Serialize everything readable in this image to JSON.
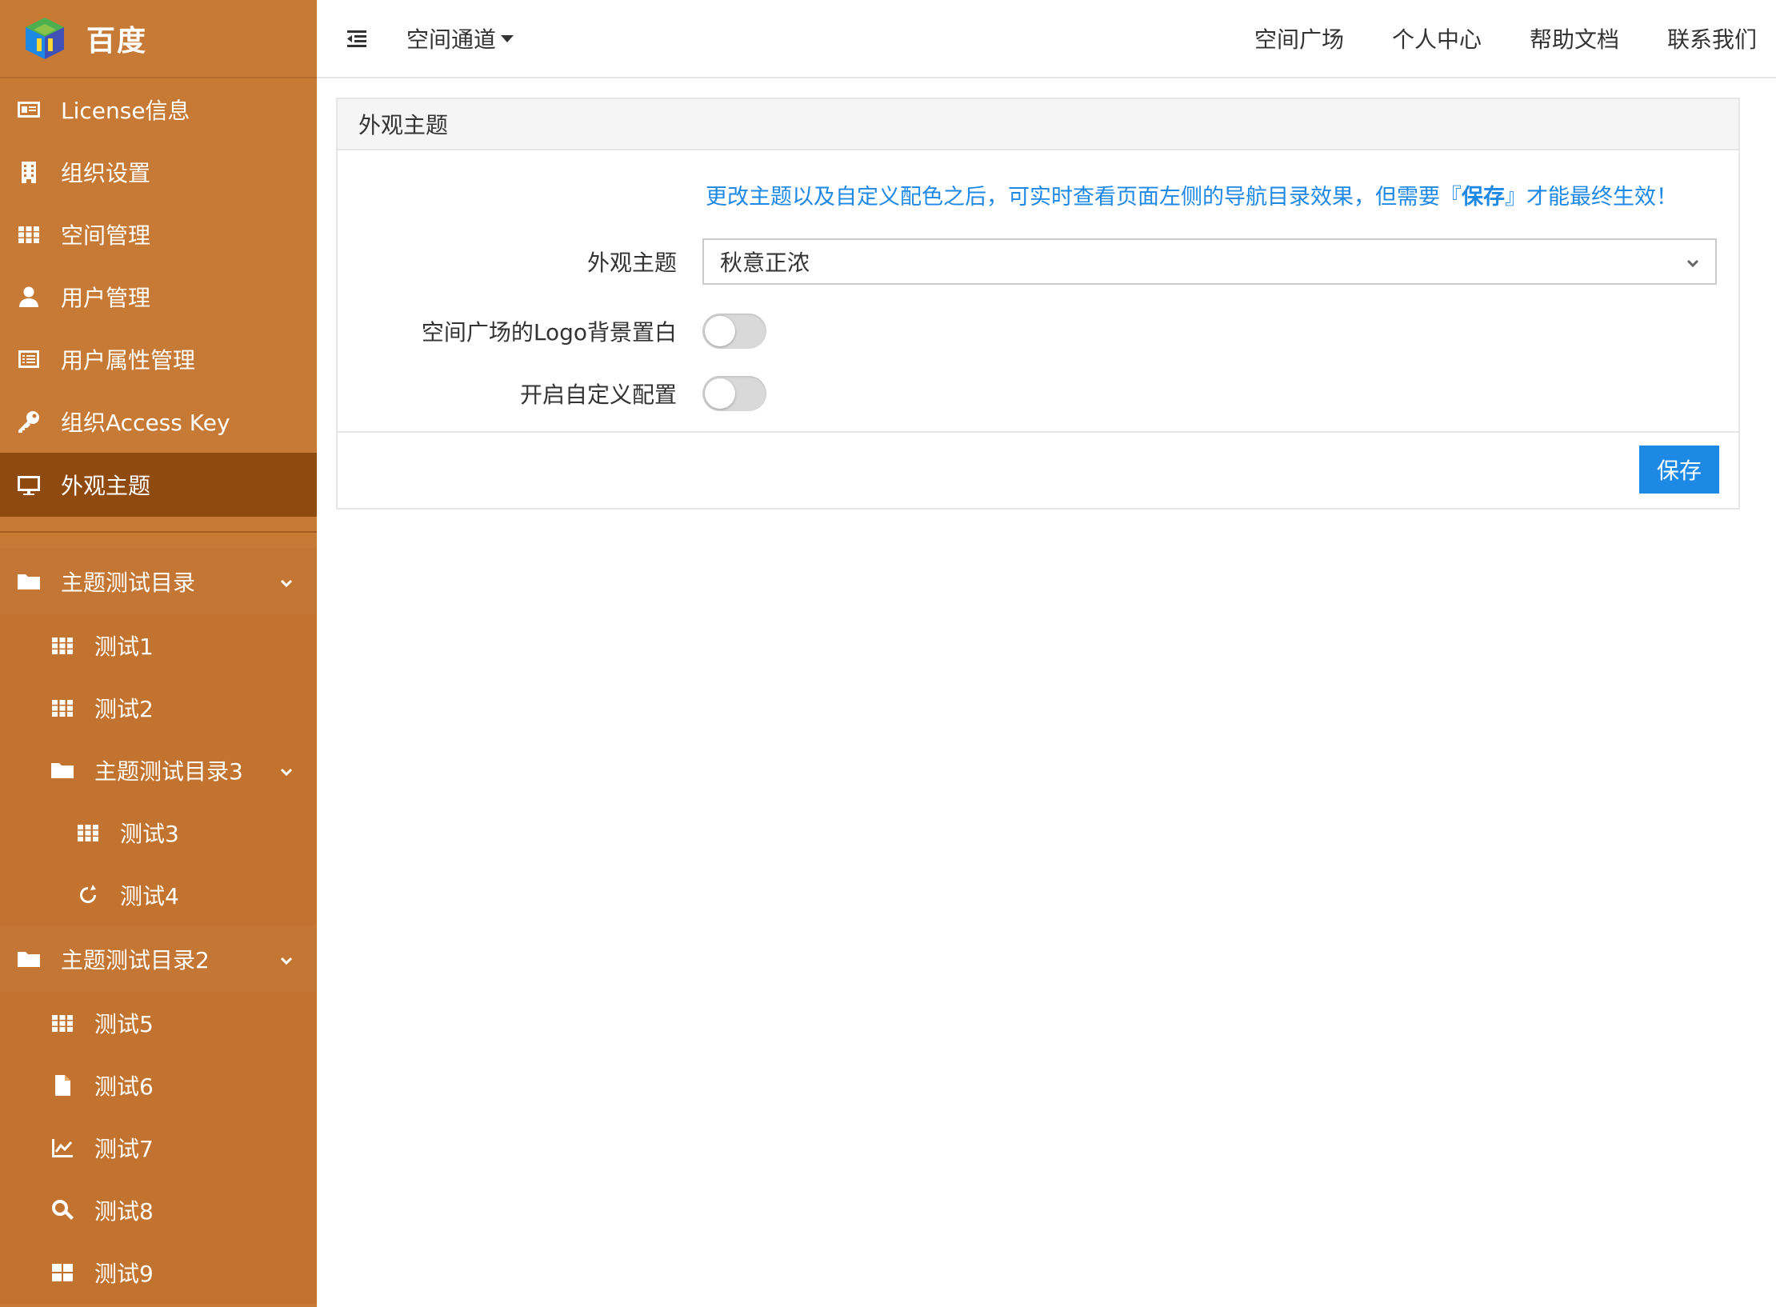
{
  "brand": {
    "name": "百度",
    "logo_icon": "cube-logo"
  },
  "sidebar": {
    "items": [
      {
        "label": "License信息",
        "icon": "id-card-icon"
      },
      {
        "label": "组织设置",
        "icon": "building-icon"
      },
      {
        "label": "空间管理",
        "icon": "grid-icon"
      },
      {
        "label": "用户管理",
        "icon": "user-icon"
      },
      {
        "label": "用户属性管理",
        "icon": "list-icon"
      },
      {
        "label": "组织Access Key",
        "icon": "key-icon"
      },
      {
        "label": "外观主题",
        "icon": "desktop-icon",
        "active": true
      }
    ],
    "tree": {
      "group1": {
        "label": "主题测试目录",
        "icon": "folder-icon"
      },
      "g1_items": [
        {
          "label": "测试1",
          "icon": "grid-icon"
        },
        {
          "label": "测试2",
          "icon": "grid-icon"
        }
      ],
      "group3": {
        "label": "主题测试目录3",
        "icon": "folder-icon"
      },
      "g3_items": [
        {
          "label": "测试3",
          "icon": "grid-icon"
        },
        {
          "label": "测试4",
          "icon": "refresh-icon"
        }
      ],
      "group2": {
        "label": "主题测试目录2",
        "icon": "folder-icon"
      },
      "g2_items": [
        {
          "label": "测试5",
          "icon": "grid-icon"
        },
        {
          "label": "测试6",
          "icon": "file-icon"
        },
        {
          "label": "测试7",
          "icon": "line-chart-icon"
        },
        {
          "label": "测试8",
          "icon": "search-icon"
        },
        {
          "label": "测试9",
          "icon": "windows-icon"
        }
      ]
    }
  },
  "topbar": {
    "space_dropdown": "空间通道",
    "links": [
      "空间广场",
      "个人中心",
      "帮助文档",
      "联系我们"
    ]
  },
  "panel": {
    "title": "外观主题",
    "notice_before": "更改主题以及自定义配色之后，可实时查看页面左侧的导航目录效果，但需要『",
    "notice_bold": "保存",
    "notice_after": "』才能最终生效！",
    "theme_label": "外观主题",
    "theme_value": "秋意正浓",
    "logo_white_label": "空间广场的Logo背景置白",
    "logo_white_on": false,
    "custom_label": "开启自定义配置",
    "custom_on": false,
    "save_label": "保存"
  },
  "colors": {
    "sidebar_bg": "#c77a36",
    "sidebar_active": "#8f4a10",
    "accent": "#1e88e5"
  }
}
